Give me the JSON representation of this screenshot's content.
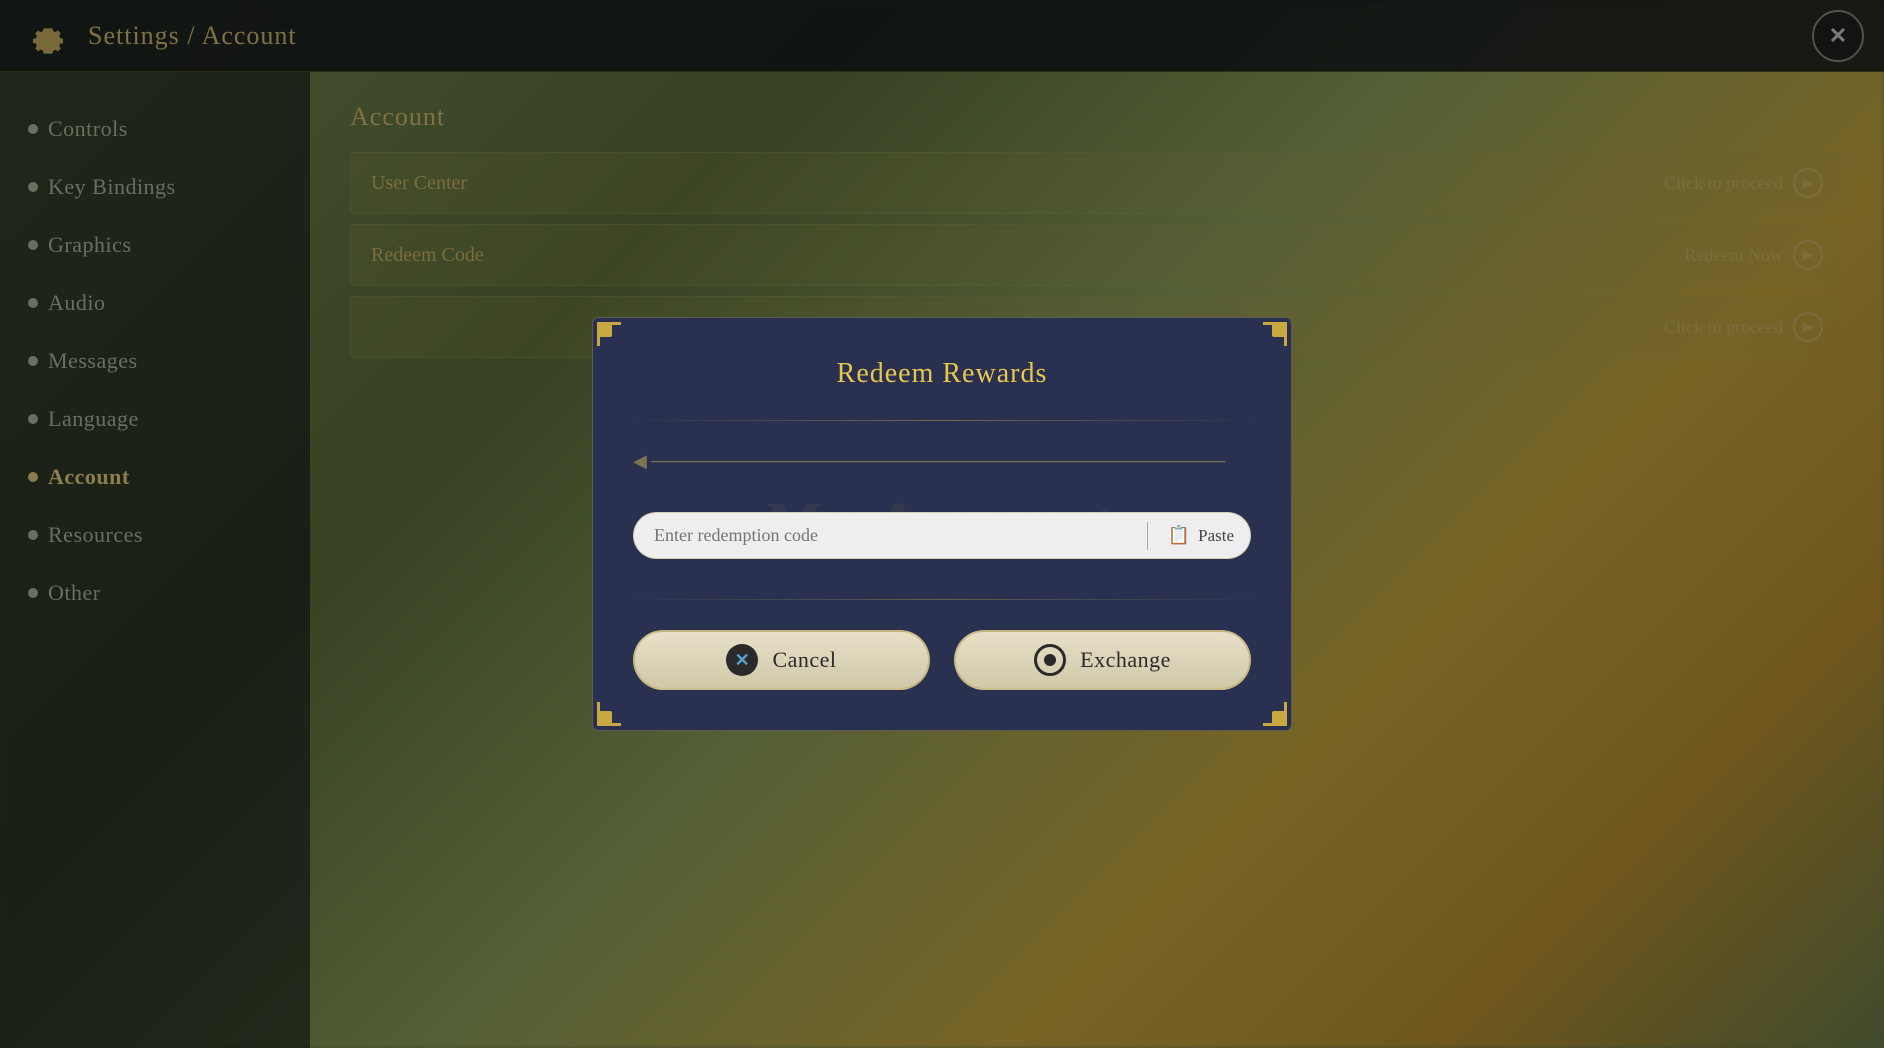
{
  "header": {
    "title": "Settings / Account",
    "close_label": "✕"
  },
  "sidebar": {
    "items": [
      {
        "id": "controls",
        "label": "Controls",
        "active": false
      },
      {
        "id": "key-bindings",
        "label": "Key Bindings",
        "active": false
      },
      {
        "id": "graphics",
        "label": "Graphics",
        "active": false
      },
      {
        "id": "audio",
        "label": "Audio",
        "active": false
      },
      {
        "id": "messages",
        "label": "Messages",
        "active": false
      },
      {
        "id": "language",
        "label": "Language",
        "active": false
      },
      {
        "id": "account",
        "label": "Account",
        "active": true
      },
      {
        "id": "resources",
        "label": "Resources",
        "active": false
      },
      {
        "id": "other",
        "label": "Other",
        "active": false
      }
    ]
  },
  "account_section": {
    "title": "Account",
    "rows": [
      {
        "id": "user-center",
        "label": "User Center",
        "action": "Click to proceed"
      },
      {
        "id": "redeem-code",
        "label": "Redeem Code",
        "action": "Redeem Now"
      },
      {
        "id": "third",
        "label": "",
        "action": "Click to proceed"
      }
    ]
  },
  "modal": {
    "title": "Redeem Rewards",
    "watermark": "My Account",
    "input_placeholder": "Enter redemption code",
    "paste_label": "Paste",
    "cancel_label": "Cancel",
    "exchange_label": "Exchange"
  }
}
